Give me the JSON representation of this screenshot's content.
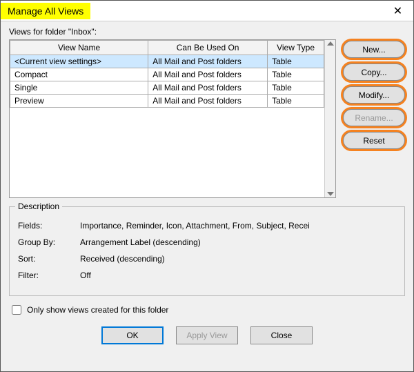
{
  "title": "Manage All Views",
  "close_glyph": "✕",
  "folder_label": "Views for folder \"Inbox\":",
  "columns": {
    "name": "View Name",
    "used": "Can Be Used On",
    "type": "View Type"
  },
  "rows": [
    {
      "name": "<Current view settings>",
      "used": "All Mail and Post folders",
      "type": "Table",
      "selected": true
    },
    {
      "name": "Compact",
      "used": "All Mail and Post folders",
      "type": "Table",
      "selected": false
    },
    {
      "name": "Single",
      "used": "All Mail and Post folders",
      "type": "Table",
      "selected": false
    },
    {
      "name": "Preview",
      "used": "All Mail and Post folders",
      "type": "Table",
      "selected": false
    }
  ],
  "buttons": {
    "new": "New...",
    "copy": "Copy...",
    "modify": "Modify...",
    "rename": "Rename...",
    "reset": "Reset"
  },
  "description": {
    "title": "Description",
    "fields_label": "Fields:",
    "fields_value": "Importance, Reminder, Icon, Attachment, From, Subject, Recei",
    "group_label": "Group By:",
    "group_value": "Arrangement Label (descending)",
    "sort_label": "Sort:",
    "sort_value": "Received (descending)",
    "filter_label": "Filter:",
    "filter_value": "Off"
  },
  "only_show_label": "Only show views created for this folder",
  "footer": {
    "ok": "OK",
    "apply": "Apply View",
    "close": "Close"
  }
}
